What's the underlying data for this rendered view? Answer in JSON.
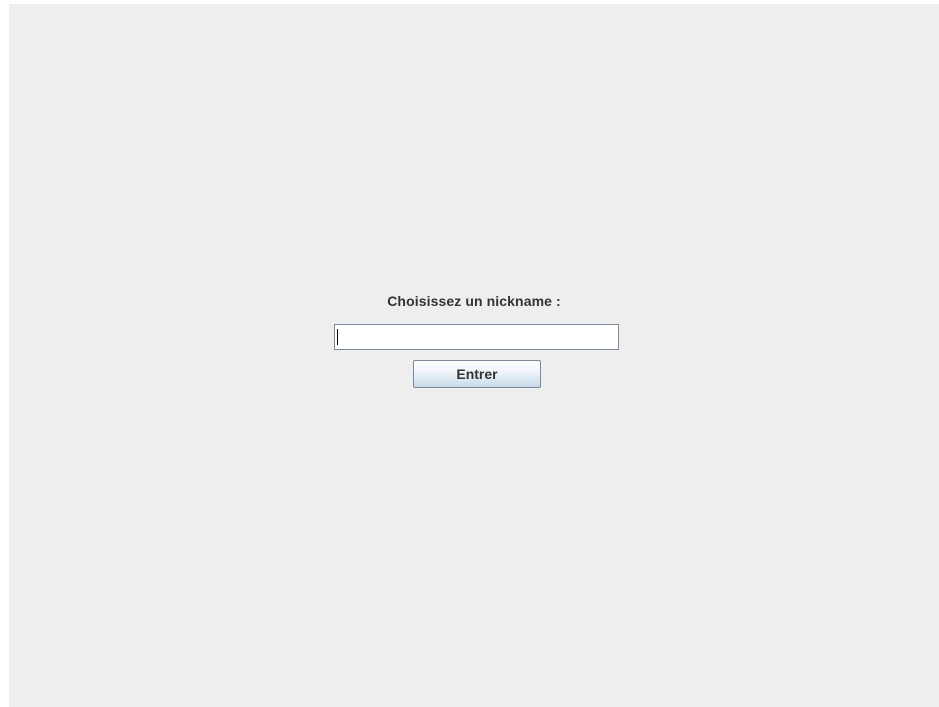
{
  "login": {
    "prompt": "Choisissez un nickname :",
    "nickname_value": "",
    "nickname_placeholder": "",
    "enter_label": "Entrer"
  }
}
